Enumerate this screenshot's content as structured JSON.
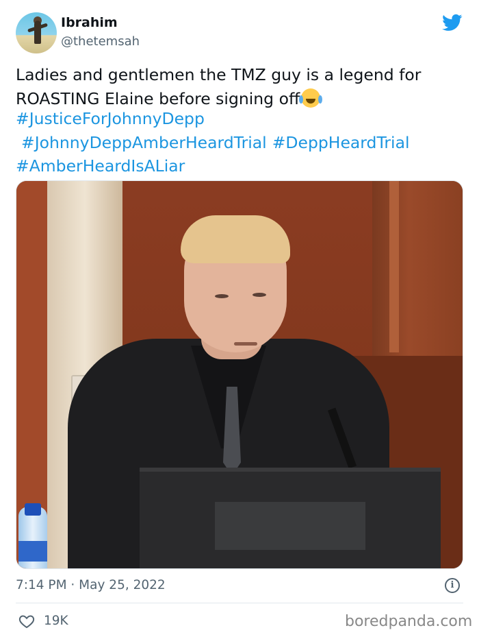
{
  "author": {
    "name": "Ibrahim",
    "handle": "@thetemsah"
  },
  "tweet": {
    "text": "Ladies and gentlemen the TMZ guy is a legend for ROASTING Elaine before signing off",
    "emoji": "face-with-tears-of-joy",
    "hashtags": [
      "#JusticeForJohnnyDepp",
      "#JohnnyDeppAmberHeardTrial",
      "#DeppHeardTrial",
      "#AmberHeardIsALiar"
    ],
    "timestamp": "7:14 PM · May 25, 2022",
    "likes": "19K"
  },
  "watermark": "boredpanda.com",
  "icons": {
    "brand": "twitter-bird-icon",
    "info": "info-icon",
    "like": "heart-icon"
  },
  "colors": {
    "link": "#1b95e0",
    "brand": "#1d9bf0",
    "muted": "#536471",
    "text": "#0f1419"
  }
}
